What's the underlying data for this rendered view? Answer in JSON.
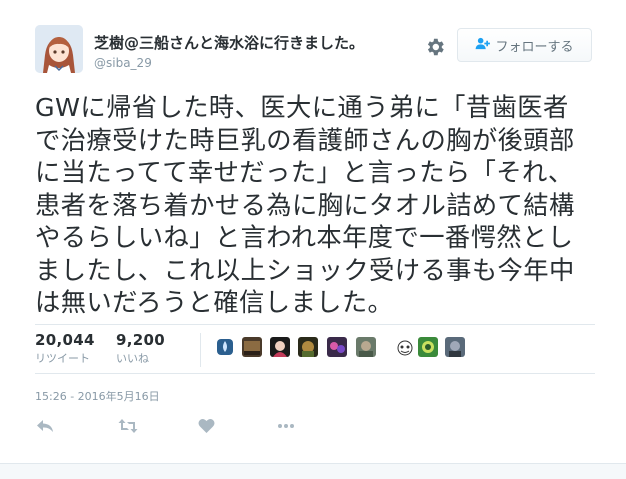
{
  "tweet": {
    "display_name": "芝樹@三船さんと海水浴に行きました。",
    "handle": "@siba_29",
    "follow_label": "フォローする",
    "text_lines": [
      "GWに帰省した時、医大に通う弟に「昔歯医者",
      "で治療受けた時巨乳の看護師さんの胸が後頭部",
      "に当たってて幸せだった」と言ったら「それ、",
      "患者を落ち着かせる為に胸にタオル詰めて結構",
      "やるらしいね」と言われ本年度で一番愕然とし",
      "ましたし、これ以上ショック受ける事も今年中",
      "は無いだろうと確信しました。"
    ],
    "retweets": {
      "count": "20,044",
      "label": "リツイート"
    },
    "likes": {
      "count": "9,200",
      "label": "いいね"
    },
    "timestamp": "15:26 - 2016年5月16日"
  },
  "icons": {
    "settings": "gear-icon",
    "follow": "add-user-icon",
    "reply": "reply-icon",
    "retweet": "retweet-icon",
    "like": "heart-icon",
    "more": "more-dots-icon"
  },
  "colors": {
    "text": "#292f33",
    "muted": "#8899a6",
    "icon": "#aab8c2",
    "border": "#e1e8ed"
  }
}
